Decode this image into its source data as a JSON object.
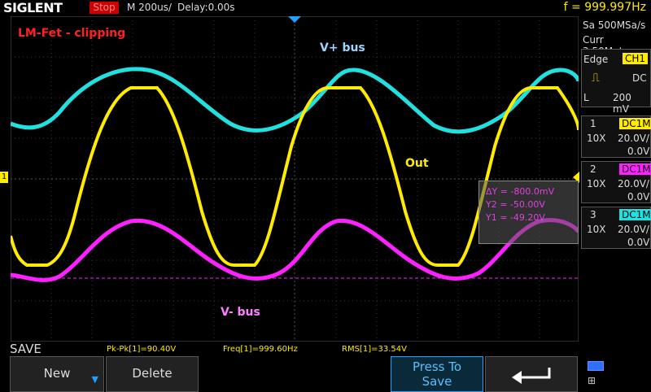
{
  "topbar": {
    "brand": "SIGLENT",
    "run_state": "Stop",
    "timebase": "M 200us/",
    "delay": "Delay:0.00s",
    "frequency": "f = 999.997Hz"
  },
  "acquisition": {
    "sample_rate": "Sa 500MSa/s",
    "memory": "Curr 3.50Mpts"
  },
  "trigger": {
    "mode_label": "Edge",
    "source": "CH1",
    "coupling": "DC",
    "level_label": "L",
    "level": "200 mV"
  },
  "channels": [
    {
      "num": "1",
      "coupling": "DC1M",
      "probe": "10X",
      "scale": "20.0V/",
      "offset": "0.0V",
      "color": "#ffeb00"
    },
    {
      "num": "2",
      "coupling": "DC1M",
      "probe": "10X",
      "scale": "20.0V/",
      "offset": "0.0V",
      "color": "#ff20ff"
    },
    {
      "num": "3",
      "coupling": "DC1M",
      "probe": "10X",
      "scale": "20.0V/",
      "offset": "0.0V",
      "color": "#20e0e0"
    }
  ],
  "annotations": {
    "title": "LM-Fet - clipping",
    "vplus": "V+ bus",
    "out": "Out",
    "vminus": "V- bus"
  },
  "cursors": {
    "delta_y": "ΔY = -800.0mV",
    "y2": "Y2 = -50.00V",
    "y1": "Y1 = -49.20V"
  },
  "ch1_marker": "1",
  "measurements": {
    "pkpk": "Pk-Pk[1]=90.40V",
    "freq": "Freq[1]=999.60Hz",
    "rms": "RMS[1]=33.54V"
  },
  "menu": {
    "title": "SAVE",
    "new_label": "New",
    "delete_label": "Delete",
    "press_to_save": "Press To Save"
  }
}
